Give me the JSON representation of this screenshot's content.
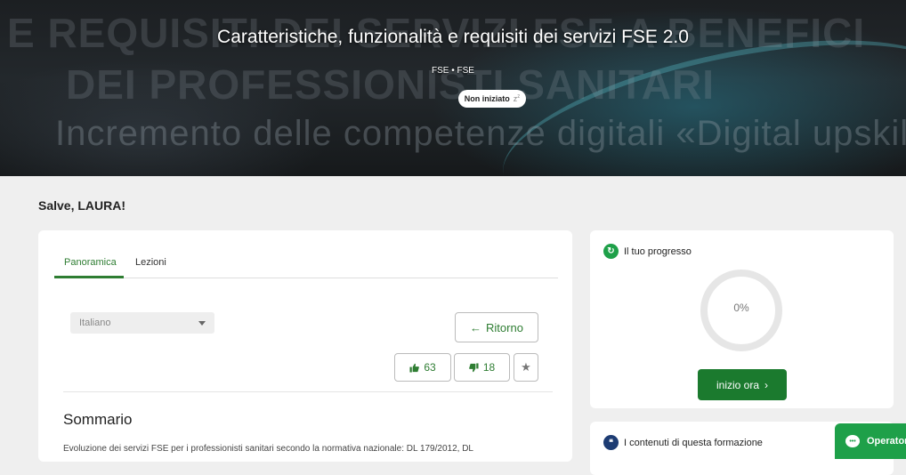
{
  "hero": {
    "title": "Caratteristiche, funzionalità e requisiti dei servizi FSE 2.0",
    "subtitle": "FSE • FSE",
    "status": "Non iniziato",
    "status_icon": "zz-sleep-icon",
    "background_lines": [
      "E REQUISITI DEI SERVIZI FSE A BENEFICI",
      "DEI PROFESSIONISTI SANITARI",
      "Incremento delle competenze digitali «Digital upskilling"
    ]
  },
  "greeting": "Salve, LAURA!",
  "main": {
    "tabs": [
      {
        "label": "Panoramica",
        "active": true
      },
      {
        "label": "Lezioni",
        "active": false
      }
    ],
    "language_select": {
      "value": "Italiano"
    },
    "back_button": {
      "label": "Ritorno",
      "icon": "arrow-left-icon"
    },
    "likes": {
      "count": "63",
      "icon": "thumbs-up-icon"
    },
    "dislikes": {
      "count": "18",
      "icon": "thumbs-down-icon"
    },
    "favorite_icon": "star-icon",
    "summary_heading": "Sommario",
    "summary_text": "Evoluzione dei servizi FSE per i professionisti sanitari secondo la normativa nazionale: DL 179/2012, DL"
  },
  "progress": {
    "title": "Il tuo progresso",
    "value_label": "0%",
    "value": 0,
    "start_button": "inizio ora",
    "accent_color": "#1b7a2e"
  },
  "contents": {
    "title": "I contenuti di questa formazione"
  },
  "operator_button": {
    "label": "Operator",
    "color": "#1ea049"
  }
}
